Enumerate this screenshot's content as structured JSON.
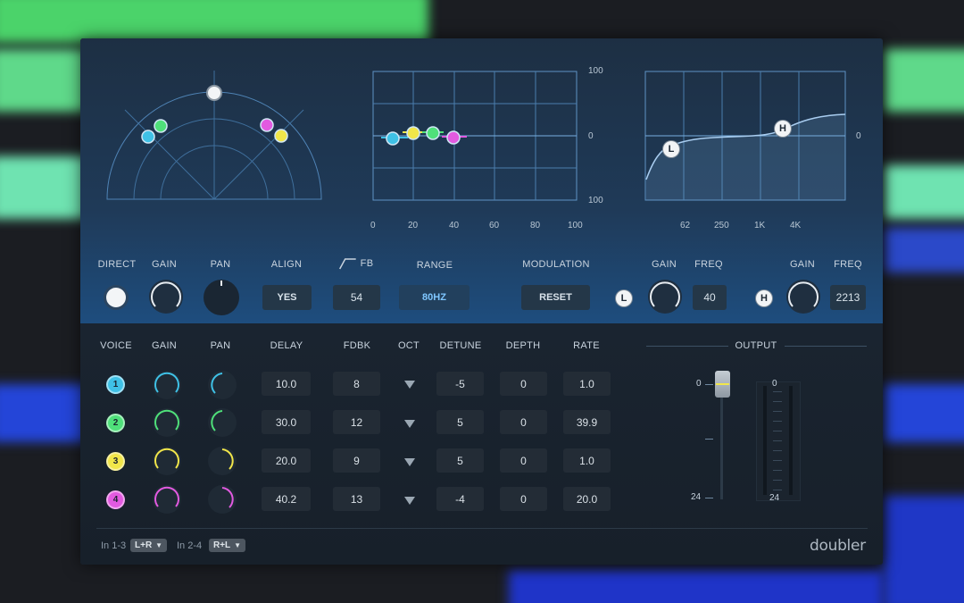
{
  "background": {
    "colors": {
      "green": "#4bd36a",
      "mint": "#6fe3b1",
      "blue": "#2445d8",
      "dark": "#1b1d22"
    }
  },
  "plugin": {
    "brand": "doubler",
    "accent": "#7fc6ff",
    "delay_graph": {
      "y_labels": [
        "100",
        "0",
        "100"
      ],
      "x_labels": [
        "0",
        "20",
        "40",
        "60",
        "80",
        "100"
      ]
    },
    "eq_graph": {
      "x_labels": [
        "62",
        "250",
        "1K",
        "4K"
      ],
      "y_label": "0",
      "low_handle": "L",
      "high_handle": "H"
    },
    "controls": {
      "direct": "DIRECT",
      "gain": "GAIN",
      "pan": "PAN",
      "align": "ALIGN",
      "align_value": "YES",
      "fb": "FB",
      "fb_value": "54",
      "range": "RANGE",
      "range_value": "80HZ",
      "modulation": "MODULATION",
      "modulation_button": "RESET",
      "low_gain": "GAIN",
      "low_freq": "FREQ",
      "low_freq_value": "40",
      "low_badge": "L",
      "high_gain": "GAIN",
      "high_freq": "FREQ",
      "high_freq_value": "2213",
      "high_badge": "H"
    },
    "voices_header": [
      "VOICE",
      "GAIN",
      "PAN",
      "DELAY",
      "FDBK",
      "OCT",
      "DETUNE",
      "DEPTH",
      "RATE"
    ],
    "voices": [
      {
        "id": "1",
        "color": "#3fc1e6",
        "delay": "10.0",
        "fdbk": "8",
        "detune": "-5",
        "depth": "0",
        "rate": "1.0"
      },
      {
        "id": "2",
        "color": "#4fe07a",
        "delay": "30.0",
        "fdbk": "12",
        "detune": "5",
        "depth": "0",
        "rate": "39.9"
      },
      {
        "id": "3",
        "color": "#f1e64a",
        "delay": "20.0",
        "fdbk": "9",
        "detune": "5",
        "depth": "0",
        "rate": "1.0"
      },
      {
        "id": "4",
        "color": "#e25ae0",
        "delay": "40.2",
        "fdbk": "13",
        "detune": "-4",
        "depth": "0",
        "rate": "20.0"
      }
    ],
    "output": {
      "title": "OUTPUT",
      "fader_top": "0",
      "fader_bottom": "24",
      "meter_top": "0",
      "meter_bottom": "24"
    },
    "footer": {
      "in13_label": "In 1-3",
      "in13_value": "L+R",
      "in24_label": "In 2-4",
      "in24_value": "R+L"
    }
  }
}
